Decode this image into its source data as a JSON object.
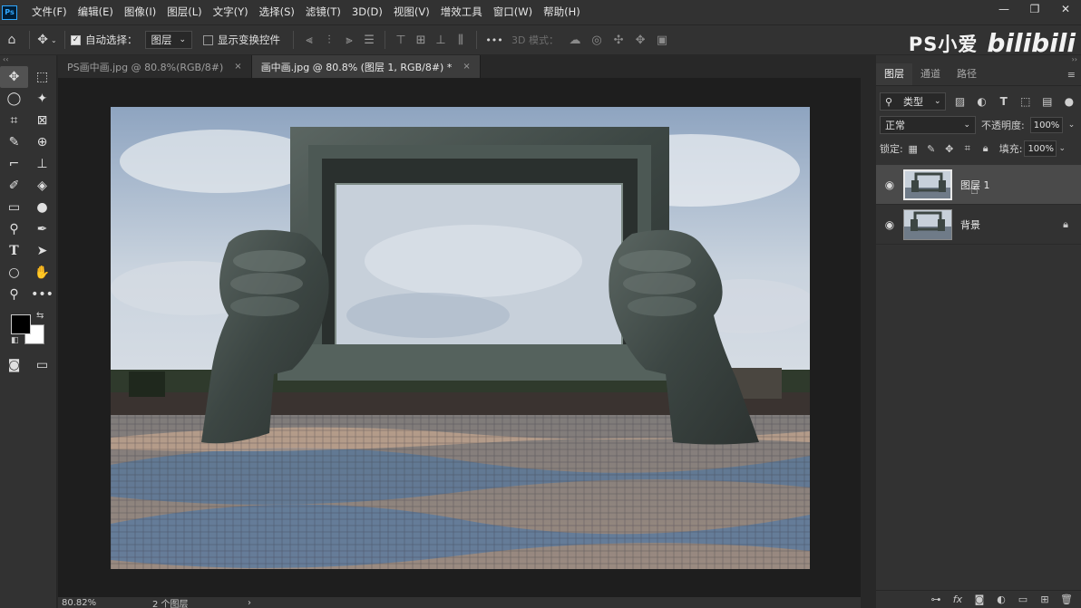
{
  "app": {
    "logo_text": "Ps",
    "menu": [
      "文件(F)",
      "编辑(E)",
      "图像(I)",
      "图层(L)",
      "文字(Y)",
      "选择(S)",
      "滤镜(T)",
      "3D(D)",
      "视图(V)",
      "增效工具",
      "窗口(W)",
      "帮助(H)"
    ],
    "window_controls": {
      "minimize": "—",
      "restore": "❐",
      "close": "✕"
    }
  },
  "options_bar": {
    "auto_select_label": "自动选择：",
    "auto_select_checked": true,
    "auto_select_target": "图层",
    "show_transform_label": "显示变换控件",
    "show_transform_checked": false,
    "more_label": "•••",
    "mode_3d_label": "3D 模式："
  },
  "watermark": {
    "text": "PS小爱",
    "logo": "bilibili"
  },
  "tabs": [
    {
      "label": "PS画中画.jpg @ 80.8%(RGB/8#)",
      "active": false,
      "close": "×"
    },
    {
      "label": "画中画.jpg @ 80.8% (图层 1, RGB/8#) *",
      "active": true,
      "close": "×"
    }
  ],
  "toolbar": {
    "collapse": "‹‹",
    "foreground_color": "#000000",
    "background_color": "#ffffff"
  },
  "status": {
    "zoom": "80.82%",
    "info": "2 个图层",
    "arrow": "›"
  },
  "layers_panel": {
    "collapse": "››",
    "tabs": [
      "图层",
      "通道",
      "路径"
    ],
    "active_tab": "图层",
    "menu_icon": "≡",
    "filter_label": "类型",
    "blend_mode": "正常",
    "opacity_label": "不透明度:",
    "opacity_value": "100%",
    "lock_label": "锁定:",
    "fill_label": "填充:",
    "fill_value": "100%",
    "layers": [
      {
        "name": "图层 1",
        "visible": true,
        "selected": true,
        "locked": false
      },
      {
        "name": "背景",
        "visible": true,
        "selected": false,
        "locked": true
      }
    ],
    "bottom_icons": [
      "link-icon",
      "fx-icon",
      "mask-icon",
      "adjustment-icon",
      "group-icon",
      "new-layer-icon",
      "trash-icon"
    ]
  },
  "colors": {
    "accent": "#31a8ff",
    "panel_bg": "#323232",
    "canvas_bg": "#1e1e1e"
  }
}
